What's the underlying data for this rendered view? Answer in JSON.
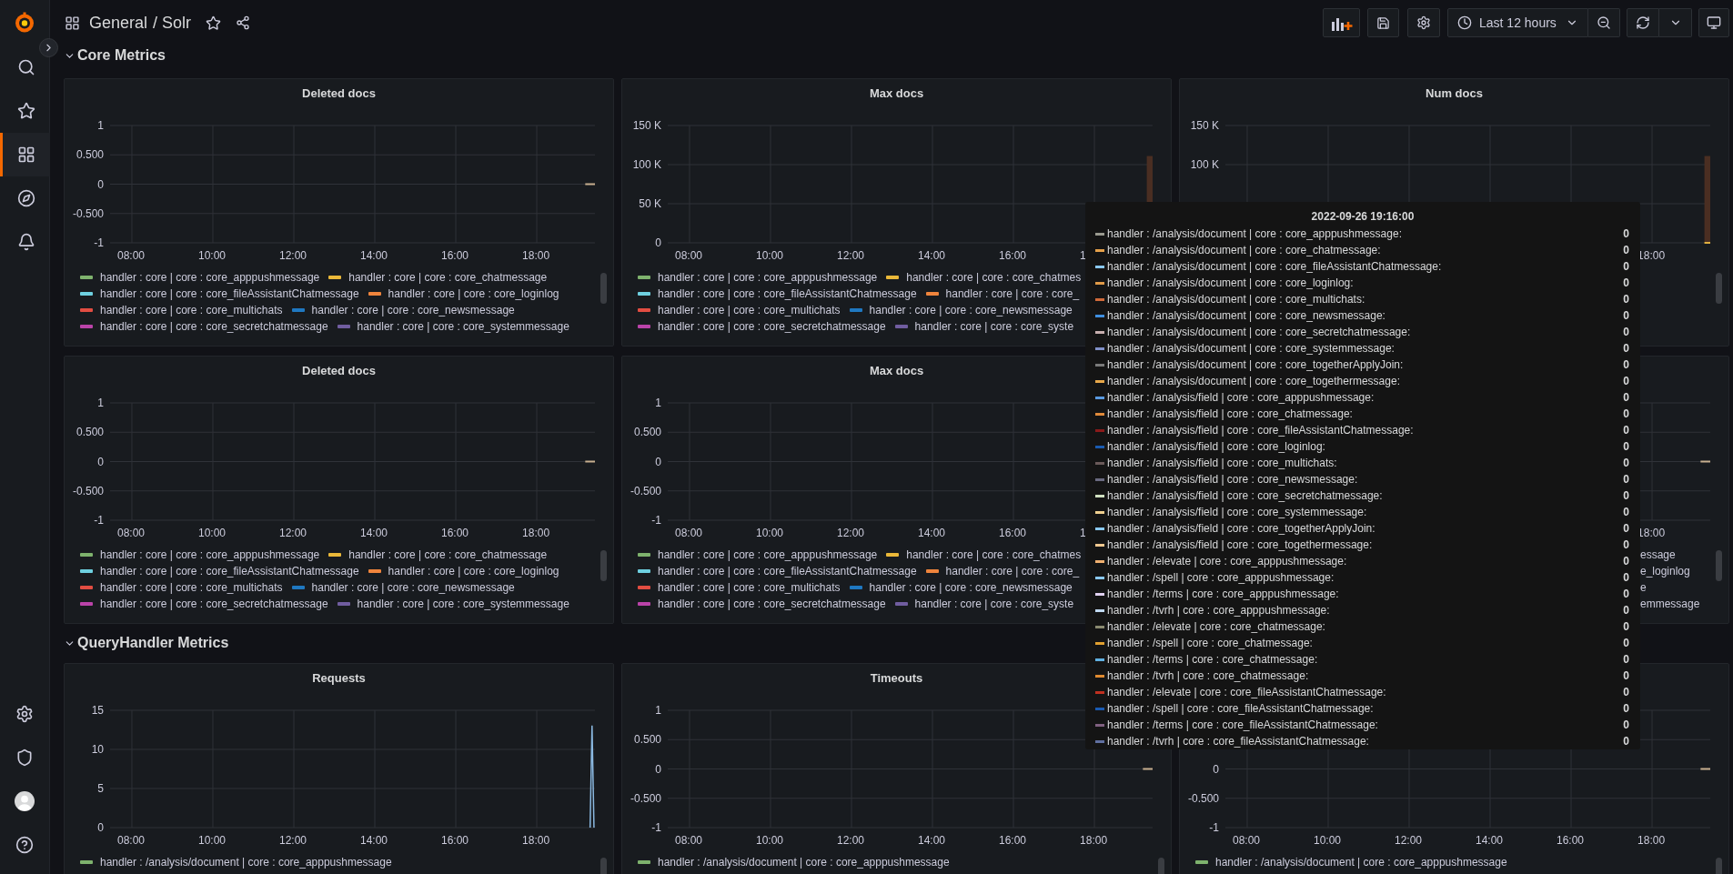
{
  "topbar": {
    "folder": "General",
    "title": "/ Solr",
    "time_range": "Last 12 hours"
  },
  "sidebar": {
    "top": [
      {
        "kind": "search",
        "selected": false
      },
      {
        "kind": "starred",
        "selected": false
      },
      {
        "kind": "dashboards",
        "selected": true
      },
      {
        "kind": "explore",
        "selected": false
      },
      {
        "kind": "alerting",
        "selected": false
      }
    ],
    "bottom": [
      {
        "kind": "settings"
      },
      {
        "kind": "admin"
      },
      {
        "kind": "profile"
      },
      {
        "kind": "help"
      }
    ]
  },
  "sections": [
    {
      "title": "Core Metrics",
      "expanded": true,
      "panels": [
        {
          "title": "Deleted docs",
          "kind": "flat",
          "yticks": [
            "1",
            "0.500",
            "0",
            "-0.500",
            "-1"
          ],
          "xticks": [
            "08:00",
            "10:00",
            "12:00",
            "14:00",
            "16:00",
            "18:00"
          ],
          "legend": [
            {
              "label": "handler : core | core : core_apppushmessage",
              "color": "#7eb26d"
            },
            {
              "label": "handler : core | core : core_chatmessage",
              "color": "#eab839"
            },
            {
              "label": "handler : core | core : core_fileAssistantChatmessage",
              "color": "#6ed0e0"
            },
            {
              "label": "handler : core | core : core_loginlog",
              "color": "#ef843c"
            },
            {
              "label": "handler : core | core : core_multichats",
              "color": "#e24d42"
            },
            {
              "label": "handler : core | core : core_newsmessage",
              "color": "#1f78c1"
            },
            {
              "label": "handler : core | core : core_secretchatmessage",
              "color": "#ba43a9"
            },
            {
              "label": "handler : core | core : core_systemmessage",
              "color": "#705da0"
            }
          ]
        },
        {
          "title": "Max docs",
          "kind": "column",
          "yticks": [
            "150 K",
            "100 K",
            "50 K",
            "0"
          ],
          "xticks": [
            "08:00",
            "10:00",
            "12:00",
            "14:00",
            "16:00",
            "1"
          ],
          "legend": [
            {
              "label": "handler : core | core : core_apppushmessage",
              "color": "#7eb26d"
            },
            {
              "label": "handler : core | core : core_chatmes",
              "color": "#eab839"
            },
            {
              "label": "handler : core | core : core_fileAssistantChatmessage",
              "color": "#6ed0e0"
            },
            {
              "label": "handler : core | core : core_",
              "color": "#ef843c"
            },
            {
              "label": "handler : core | core : core_multichats",
              "color": "#e24d42"
            },
            {
              "label": "handler : core | core : core_newsmessage",
              "color": "#1f78c1"
            },
            {
              "label": "handler : core | core : core_secretchatmessage",
              "color": "#ba43a9"
            },
            {
              "label": "handler : core | core : core_syste",
              "color": "#705da0"
            }
          ]
        },
        {
          "title": "Num docs",
          "kind": "column",
          "yticks": [
            "150 K",
            "100 K"
          ],
          "xticks": [
            "18:00"
          ]
        },
        {
          "title": "Deleted docs",
          "kind": "flat",
          "yticks": [
            "1",
            "0.500",
            "0",
            "-0.500",
            "-1"
          ],
          "xticks": [
            "08:00",
            "10:00",
            "12:00",
            "14:00",
            "16:00",
            "18:00"
          ],
          "legend": [
            {
              "label": "handler : core | core : core_apppushmessage",
              "color": "#7eb26d"
            },
            {
              "label": "handler : core | core : core_chatmessage",
              "color": "#eab839"
            },
            {
              "label": "handler : core | core : core_fileAssistantChatmessage",
              "color": "#6ed0e0"
            },
            {
              "label": "handler : core | core : core_loginlog",
              "color": "#ef843c"
            },
            {
              "label": "handler : core | core : core_multichats",
              "color": "#e24d42"
            },
            {
              "label": "handler : core | core : core_newsmessage",
              "color": "#1f78c1"
            },
            {
              "label": "handler : core | core : core_secretchatmessage",
              "color": "#ba43a9"
            },
            {
              "label": "handler : core | core : core_systemmessage",
              "color": "#705da0"
            }
          ]
        },
        {
          "title": "Max docs",
          "kind": "none",
          "yticks": [
            "1",
            "0.500",
            "0",
            "-0.500",
            "-1"
          ],
          "xticks": [
            "08:00",
            "10:00",
            "12:00",
            "14:00",
            "16:00",
            "1"
          ],
          "legend": [
            {
              "label": "handler : core | core : core_apppushmessage",
              "color": "#7eb26d"
            },
            {
              "label": "handler : core | core : core_chatmes",
              "color": "#eab839"
            },
            {
              "label": "handler : core | core : core_fileAssistantChatmessage",
              "color": "#6ed0e0"
            },
            {
              "label": "handler : core | core : core_",
              "color": "#ef843c"
            },
            {
              "label": "handler : core | core : core_multichats",
              "color": "#e24d42"
            },
            {
              "label": "handler : core | core : core_newsmessage",
              "color": "#1f78c1"
            },
            {
              "label": "handler : core | core : core_secretchatmessage",
              "color": "#ba43a9"
            },
            {
              "label": "handler : core | core : core_syste",
              "color": "#705da0"
            }
          ]
        },
        {
          "kind": "flat",
          "xticks": [
            "18:00"
          ],
          "legend_fragments": [
            "essage",
            "e_loginlog",
            "e",
            "emmessage"
          ]
        }
      ]
    },
    {
      "title": "QueryHandler Metrics",
      "expanded": true,
      "panels": [
        {
          "title": "Requests",
          "kind": "spike",
          "yticks": [
            "15",
            "10",
            "5",
            "0"
          ],
          "xticks": [
            "08:00",
            "10:00",
            "12:00",
            "14:00",
            "16:00",
            "18:00"
          ],
          "legend": [
            {
              "label": "handler : /analysis/document | core : core_apppushmessage",
              "color": "#7eb26d"
            }
          ]
        },
        {
          "title": "Timeouts",
          "kind": "flat",
          "yticks": [
            "1",
            "0.500",
            "0",
            "-0.500",
            "-1"
          ],
          "xticks": [
            "08:00",
            "10:00",
            "12:00",
            "14:00",
            "16:00",
            "18:00"
          ],
          "legend": [
            {
              "label": "handler : /analysis/document | core : core_apppushmessage",
              "color": "#7eb26d"
            }
          ]
        },
        {
          "kind": "flat",
          "yticks": [
            "0",
            "-0.500",
            "-1"
          ],
          "xticks": [
            "08:00",
            "10:00",
            "12:00",
            "14:00",
            "16:00",
            "18:00"
          ],
          "legend": [
            {
              "label": "handler : /analysis/document | core : core_apppushmessage",
              "color": "#7eb26d"
            }
          ]
        }
      ]
    }
  ],
  "tooltip": {
    "time": "2022-09-26 19:16:00",
    "rows": [
      {
        "label": "handler : /analysis/document | core : core_apppushmessage:",
        "color": "#9a9a8f",
        "value": "0"
      },
      {
        "label": "handler : /analysis/document | core : core_chatmessage:",
        "color": "#e5a04a",
        "value": "0"
      },
      {
        "label": "handler : /analysis/document | core : core_fileAssistantChatmessage:",
        "color": "#8ac8f0",
        "value": "0"
      },
      {
        "label": "handler : /analysis/document | core : core_loginlog:",
        "color": "#e09a48",
        "value": "0"
      },
      {
        "label": "handler : /analysis/document | core : core_multichats:",
        "color": "#d06a3a",
        "value": "0"
      },
      {
        "label": "handler : /analysis/document | core : core_newsmessage:",
        "color": "#3f8fe0",
        "value": "0"
      },
      {
        "label": "handler : /analysis/document | core : core_secretchatmessage:",
        "color": "#c8b0b0",
        "value": "0"
      },
      {
        "label": "handler : /analysis/document | core : core_systemmessage:",
        "color": "#8090c8",
        "value": "0"
      },
      {
        "label": "handler : /analysis/document | core : core_togetherApplyJoin:",
        "color": "#7a7a7a",
        "value": "0"
      },
      {
        "label": "handler : /analysis/document | core : core_togethermessage:",
        "color": "#e8a84a",
        "value": "0"
      },
      {
        "label": "handler : /analysis/field | core : core_apppushmessage:",
        "color": "#5a9ae0",
        "value": "0"
      },
      {
        "label": "handler : /analysis/field | core : core_chatmessage:",
        "color": "#e08a3a",
        "value": "0"
      },
      {
        "label": "handler : /analysis/field | core : core_fileAssistantChatmessage:",
        "color": "#8a1a1a",
        "value": "0"
      },
      {
        "label": "handler : /analysis/field | core : core_loginlog:",
        "color": "#1a5ab0",
        "value": "0"
      },
      {
        "label": "handler : /analysis/field | core : core_multichats:",
        "color": "#6a5a5a",
        "value": "0"
      },
      {
        "label": "handler : /analysis/field | core : core_newsmessage:",
        "color": "#6a6a80",
        "value": "0"
      },
      {
        "label": "handler : /analysis/field | core : core_secretchatmessage:",
        "color": "#d0e0c0",
        "value": "0"
      },
      {
        "label": "handler : /analysis/field | core : core_systemmessage:",
        "color": "#f0d090",
        "value": "0"
      },
      {
        "label": "handler : /analysis/field | core : core_togetherApplyJoin:",
        "color": "#8ac8f1",
        "value": "0"
      },
      {
        "label": "handler : /analysis/field | core : core_togethermessage:",
        "color": "#f0c890",
        "value": "0"
      },
      {
        "label": "handler : /elevate | core : core_apppushmessage:",
        "color": "#f0b070",
        "value": "0"
      },
      {
        "label": "handler : /spell | core : core_apppushmessage:",
        "color": "#8ac8f2",
        "value": "0"
      },
      {
        "label": "handler : /terms | core : core_apppushmessage:",
        "color": "#e0d0f0",
        "value": "0"
      },
      {
        "label": "handler : /tvrh | core : core_apppushmessage:",
        "color": "#c0d8f0",
        "value": "0"
      },
      {
        "label": "handler : /elevate | core : core_chatmessage:",
        "color": "#8a8a70",
        "value": "0"
      },
      {
        "label": "handler : /spell | core : core_chatmessage:",
        "color": "#e0a030",
        "value": "0"
      },
      {
        "label": "handler : /terms | core : core_chatmessage:",
        "color": "#60b0e0",
        "value": "0"
      },
      {
        "label": "handler : /tvrh | core : core_chatmessage:",
        "color": "#e08a30",
        "value": "0"
      },
      {
        "label": "handler : /elevate | core : core_fileAssistantChatmessage:",
        "color": "#c03020",
        "value": "0"
      },
      {
        "label": "handler : /spell | core : core_fileAssistantChatmessage:",
        "color": "#1a5ab1",
        "value": "0"
      },
      {
        "label": "handler : /terms | core : core_fileAssistantChatmessage:",
        "color": "#806080",
        "value": "0"
      },
      {
        "label": "handler : /tvrh | core : core_fileAssistantChatmessage:",
        "color": "#6070a0",
        "value": "0"
      }
    ]
  }
}
